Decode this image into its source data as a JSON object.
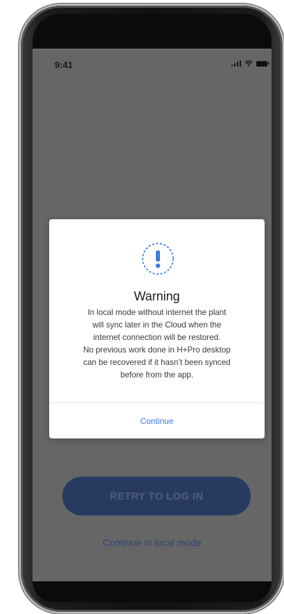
{
  "status_bar": {
    "time": "9:41",
    "signal_icon": "cellular-signal-icon",
    "wifi_icon": "wifi-icon",
    "battery_icon": "battery-icon"
  },
  "main": {
    "retry_button_label": "RETRY TO LOG IN",
    "local_mode_link": "Continue in local mode"
  },
  "dialog": {
    "icon": "warning-icon",
    "title": "Warning",
    "message_lines": [
      "In local mode without internet the plant",
      "will sync later in the Cloud when the",
      "internet connection will be restored.",
      "No previous work done in H+Pro desktop",
      "can be recovered if it hasn’t been synced",
      "before from the app."
    ],
    "continue_label": "Continue"
  },
  "colors": {
    "overlay": "#666666",
    "accent_blue": "#3c7ce0",
    "retry_button_bg": "#283a60",
    "dialog_bg": "#ffffff"
  }
}
